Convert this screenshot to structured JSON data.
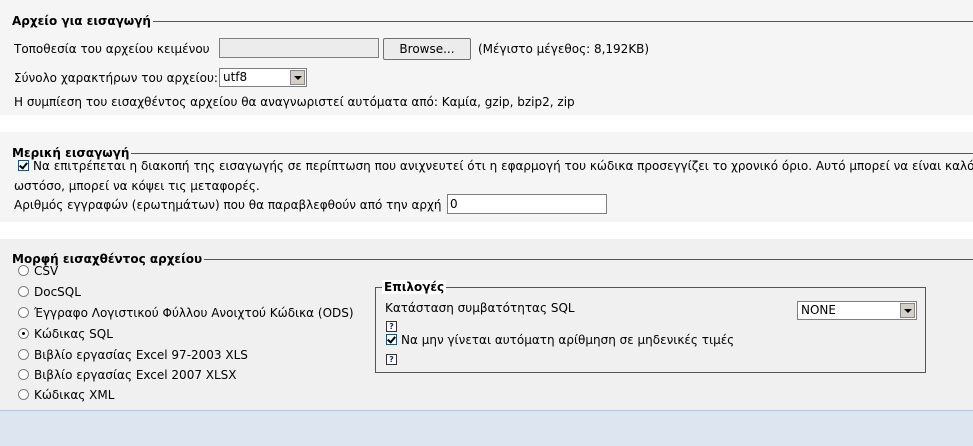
{
  "file_section": {
    "legend": "Αρχείο για εισαγωγή",
    "location_label": "Τοποθεσία του αρχείου κειμένου",
    "browse_label": "Browse...",
    "max_size": "(Μέγιστο μέγεθος: 8,192KB)",
    "charset_label": "Σύνολο χαρακτήρων του αρχείου:",
    "charset_value": "utf8",
    "compression_text": "Η συμπίεση του εισαχθέντος αρχείου θα αναγνωριστεί αυτόματα από: Καμία, gzip, bzip2, zip"
  },
  "partial_section": {
    "legend": "Μερική εισαγωγή",
    "interrupt_label": "Να επιτρέπεται η διακοπή της εισαγωγής σε περίπτωση που ανιχνευτεί ότι η εφαρμογή του κώδικα προσεγγίζει το χρονικό όριο. Αυτό μπορεί να είναι καλό",
    "interrupt_continued": "ωστόσο, μπορεί να κόψει τις μεταφορές.",
    "interrupt_checked": true,
    "skip_label": "Αριθμός εγγραφών (ερωτημάτων) που θα παραβλεφθούν από την αρχή",
    "skip_value": "0"
  },
  "format_section": {
    "legend": "Μορφή εισαχθέντος αρχείου",
    "formats": [
      {
        "label": "CSV",
        "checked": false
      },
      {
        "label": "DocSQL",
        "checked": false
      },
      {
        "label": "Έγγραφο Λογιστικού Φύλλου Ανοιχτού Κώδικα (ODS)",
        "checked": false
      },
      {
        "label": "Κώδικας SQL",
        "checked": true
      },
      {
        "label": "Βιβλίο εργασίας Excel 97-2003 XLS",
        "checked": false
      },
      {
        "label": "Βιβλίο εργασίας Excel 2007 XLSX",
        "checked": false
      },
      {
        "label": "Κώδικας XML",
        "checked": false
      }
    ]
  },
  "options": {
    "legend": "Επιλογές",
    "compat_label": "Κατάσταση συμβατότητας SQL",
    "compat_value": "NONE",
    "help_glyph": "?",
    "auto_increment_label": "Να μην γίνεται αυτόματη αρίθμηση σε μηδενικές τιμές",
    "auto_increment_checked": true
  },
  "colors": {
    "footer_bg": "#dde6f0",
    "section_bg": "#f5f5f5"
  }
}
